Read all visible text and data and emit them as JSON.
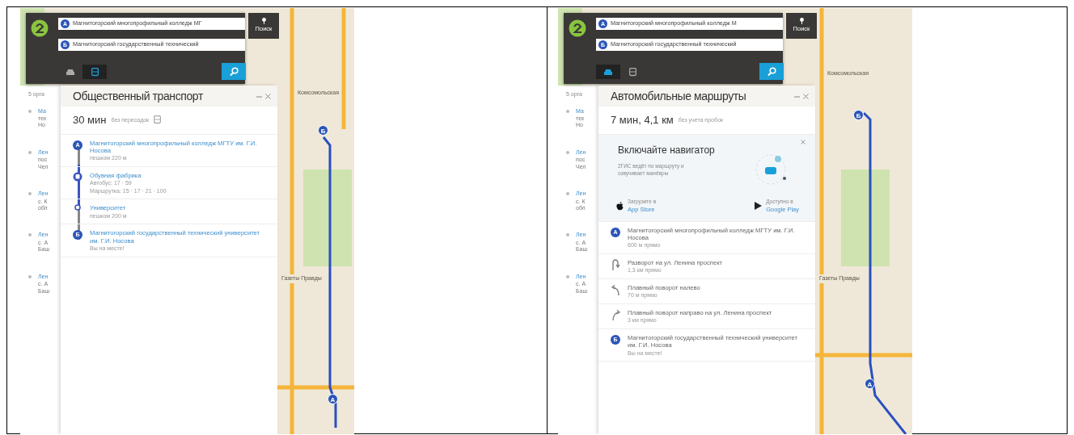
{
  "shots": [
    {
      "kind": "transit",
      "search": {
        "from": {
          "marker": "А",
          "value": "Магнитогорский многопрофильный колледж МГ"
        },
        "to": {
          "marker": "Б",
          "value": "Магнитогорский государственный технический"
        },
        "modes": [
          {
            "kind": "car",
            "selected": false
          },
          {
            "kind": "bus",
            "selected": true
          }
        ],
        "search_label": "Поиск"
      },
      "list": {
        "header": "5 орга",
        "items": [
          {
            "title": "Ма",
            "lines": [
              "тех",
              "Но"
            ]
          },
          {
            "title": "Лен",
            "lines": [
              "пос",
              "Чел"
            ]
          },
          {
            "title": "Лен",
            "lines": [
              "с. К",
              "обл"
            ]
          },
          {
            "title": "Лен",
            "lines": [
              "с. А",
              "Баш"
            ]
          },
          {
            "title": "Лен",
            "lines": [
              "с. А",
              "Баш"
            ]
          }
        ]
      },
      "route": {
        "title": "Общественный транспорт",
        "time": "30 мин",
        "note": "без пересадок"
      },
      "steps": [
        {
          "kind": "start",
          "marker": "А",
          "title": "Магнитогорский многопрофильный колледж МГТУ им. Г.И. Носова",
          "details": [
            "пешком 220 м"
          ]
        },
        {
          "kind": "bus",
          "title": "Обувная фабрика",
          "details": [
            "Автобус: 17 · 59",
            "Маршрутка: 15 · 17 · 21 · 100"
          ]
        },
        {
          "kind": "stop",
          "title": "Университет",
          "details": [
            "пешком 200 м"
          ]
        },
        {
          "kind": "finish",
          "marker": "Б",
          "title": "Магнитогорский государственный технический университет им. Г.И. Носова",
          "details": [
            "Вы на месте!"
          ]
        }
      ],
      "map": {
        "labels": [
          "Комсомольская",
          "Газеты Правды"
        ],
        "markers": [
          {
            "label": "Б"
          },
          {
            "label": "А"
          }
        ]
      }
    },
    {
      "kind": "car",
      "search": {
        "from": {
          "marker": "А",
          "value": "Магнитогорский многопрофильный колледж М"
        },
        "to": {
          "marker": "Б",
          "value": "Магнитогорский государственный технический"
        },
        "modes": [
          {
            "kind": "car",
            "selected": true
          },
          {
            "kind": "bus",
            "selected": false
          }
        ],
        "search_label": "Поиск"
      },
      "list": {
        "header": "5 орга",
        "items": [
          {
            "title": "Ма",
            "lines": [
              "тех",
              "Но"
            ]
          },
          {
            "title": "Лен",
            "lines": [
              "пос",
              "Чел"
            ]
          },
          {
            "title": "Лен",
            "lines": [
              "с. К",
              "обл"
            ]
          },
          {
            "title": "Лен",
            "lines": [
              "с. А",
              "Баш"
            ]
          },
          {
            "title": "Лен",
            "lines": [
              "с. А",
              "Баш"
            ]
          }
        ]
      },
      "route": {
        "title": "Автомобильные маршруты",
        "time": "7 мин, 4,1 км",
        "note": "без учета пробок"
      },
      "promo": {
        "title": "Включайте навигатор",
        "text": "2ГИС ведёт по маршруту и озвучивает манёвры",
        "stores": [
          {
            "kind": "apple",
            "caption": "Загрузите в",
            "name": "App Store"
          },
          {
            "kind": "google",
            "caption": "Доступно в",
            "name": "Google Play"
          }
        ]
      },
      "steps": [
        {
          "kind": "start",
          "marker": "А",
          "title": "Магнитогорский многопрофильный колледж МГТУ им. Г.И. Носова",
          "details": [
            "600 м прямо"
          ]
        },
        {
          "kind": "uturn",
          "title": "Разворот на ул. Ленина проспект",
          "details": [
            "1,3 км прямо"
          ]
        },
        {
          "kind": "left",
          "title": "Плавный поворот налево",
          "details": [
            "70 м прямо"
          ]
        },
        {
          "kind": "right",
          "title": "Плавный поворот направо на ул. Ленина проспект",
          "details": [
            "3 км прямо"
          ]
        },
        {
          "kind": "finish",
          "marker": "Б",
          "title": "Магнитогорский государственный технический университет им. Г.И. Носова",
          "details": [
            "Вы на месте!"
          ]
        }
      ],
      "map": {
        "labels": [
          "Комсомольская",
          "Газеты Правды"
        ],
        "markers": [
          {
            "label": "Б"
          },
          {
            "label": "А"
          }
        ]
      }
    }
  ]
}
